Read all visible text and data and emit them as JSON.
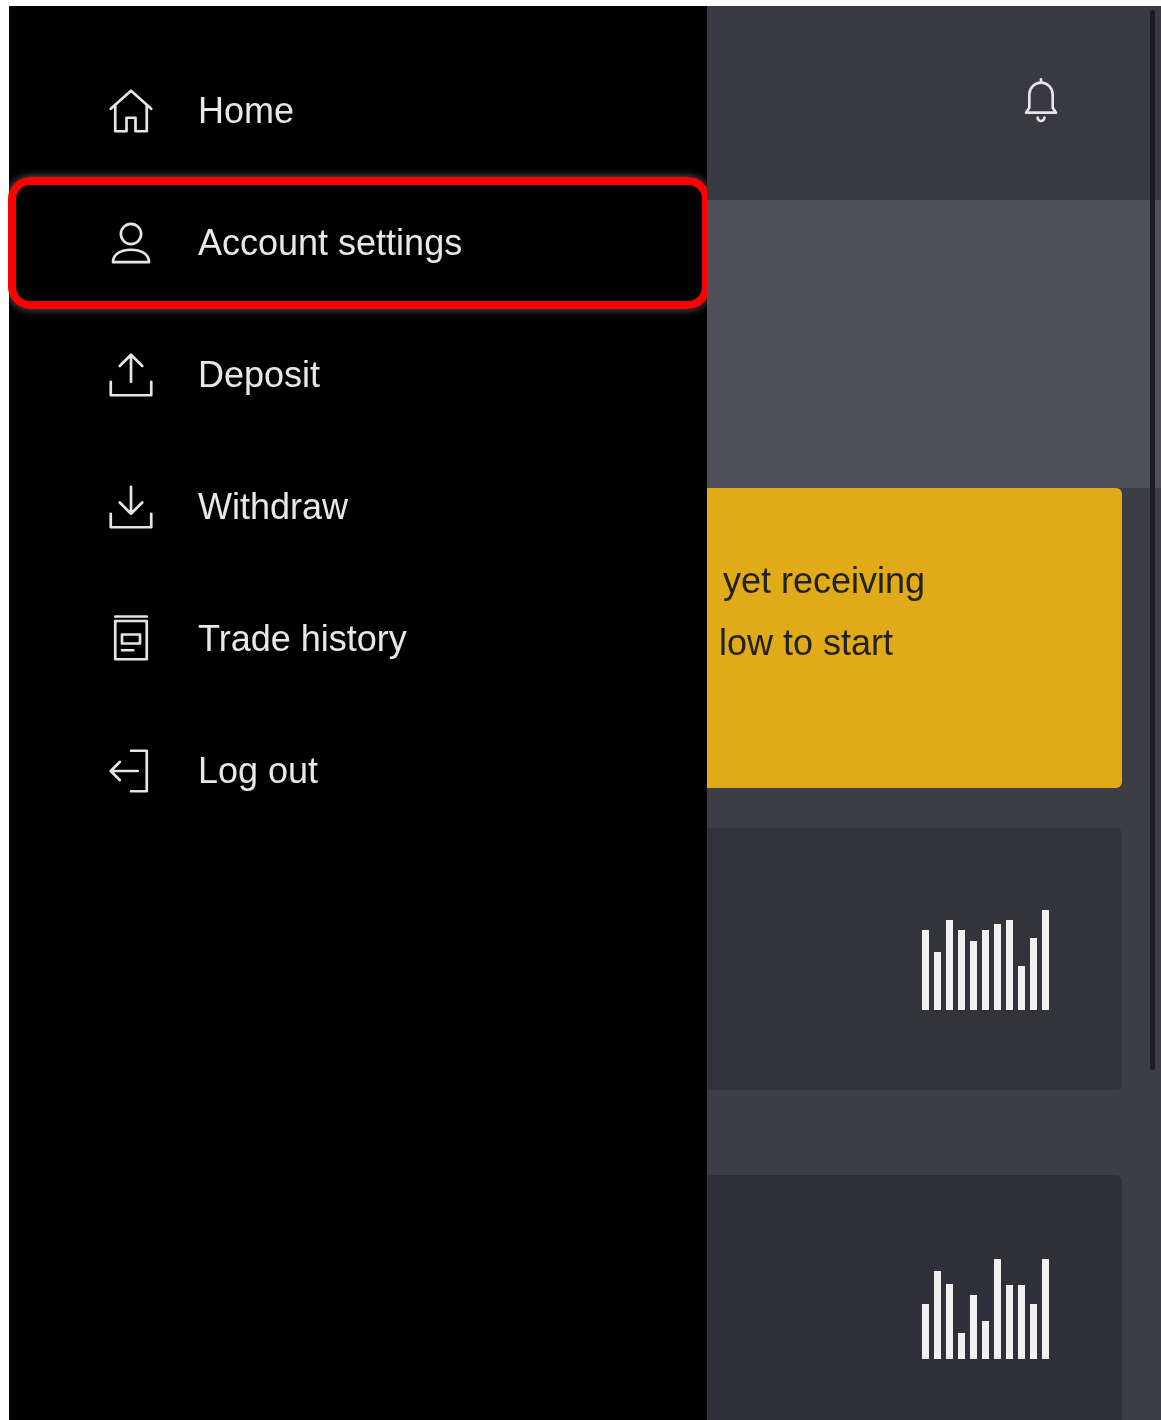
{
  "menu": [
    {
      "label": "Home",
      "kind": "home",
      "highlighted": false
    },
    {
      "label": "Account settings",
      "kind": "account",
      "highlighted": true
    },
    {
      "label": "Deposit",
      "kind": "deposit",
      "highlighted": false
    },
    {
      "label": "Withdraw",
      "kind": "withdraw",
      "highlighted": false
    },
    {
      "label": "Trade history",
      "kind": "history",
      "highlighted": false
    },
    {
      "label": "Log out",
      "kind": "logout",
      "highlighted": false
    }
  ],
  "alert": {
    "lines": [
      "yet receiving",
      "low to start"
    ]
  }
}
